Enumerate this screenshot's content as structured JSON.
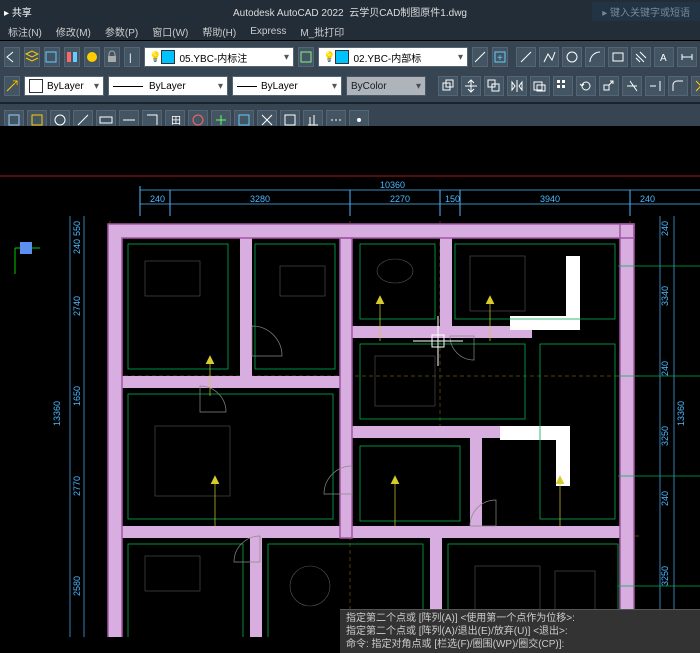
{
  "app": {
    "title": "Autodesk AutoCAD 2022",
    "file": "云学贝CAD制图原件1.dwg",
    "share": "共享",
    "hint": "键入关键字或短语"
  },
  "menu": [
    "标注(N)",
    "修改(M)",
    "参数(P)",
    "窗口(W)",
    "帮助(H)",
    "Express",
    "M_批打印"
  ],
  "layer_dd": [
    {
      "layer_name": "05.YBC-内标注",
      "color": "#00c2ff"
    },
    {
      "layer_name": "02.YBC-内部标",
      "color": "#00c2ff"
    }
  ],
  "props": {
    "color": "ByLayer",
    "linetype": "ByLayer",
    "lineweight": "ByLayer",
    "plotstyle": "ByColor"
  },
  "dims_top": [
    {
      "v": "240"
    },
    {
      "v": "3280"
    },
    {
      "v": "2270"
    },
    {
      "v": "150"
    },
    {
      "v": "3940"
    },
    {
      "v": "240"
    }
  ],
  "dims_top_total": "10360",
  "dims_left": [
    {
      "v": "550"
    },
    {
      "v": "240"
    },
    {
      "v": "2740"
    },
    {
      "v": "1650"
    },
    {
      "v": "2770"
    },
    {
      "v": "2580"
    }
  ],
  "dims_left_total": "13360",
  "dims_right": [
    {
      "v": "240"
    },
    {
      "v": "3340"
    },
    {
      "v": "240"
    },
    {
      "v": "3250"
    },
    {
      "v": "240"
    },
    {
      "v": "3250"
    }
  ],
  "dims_right_total": "13360",
  "cmd": {
    "l1": "指定第二个点或 [阵列(A)] <使用第一个点作为位移>:",
    "l2": "指定第二个点或 [阵列(A)/退出(E)/放弃(U)] <退出>:",
    "l3": "命令: 指定对角点或 [栏选(F)/圈围(WP)/圈交(CP)]:"
  },
  "colors": {
    "wall": "#d8aee0",
    "wallLine": "#a455a4",
    "dim": "#4db8ff",
    "green": "#00b050",
    "yellow": "#d6cc2a",
    "red": "#e0262e",
    "dash": "#6b5a00"
  }
}
